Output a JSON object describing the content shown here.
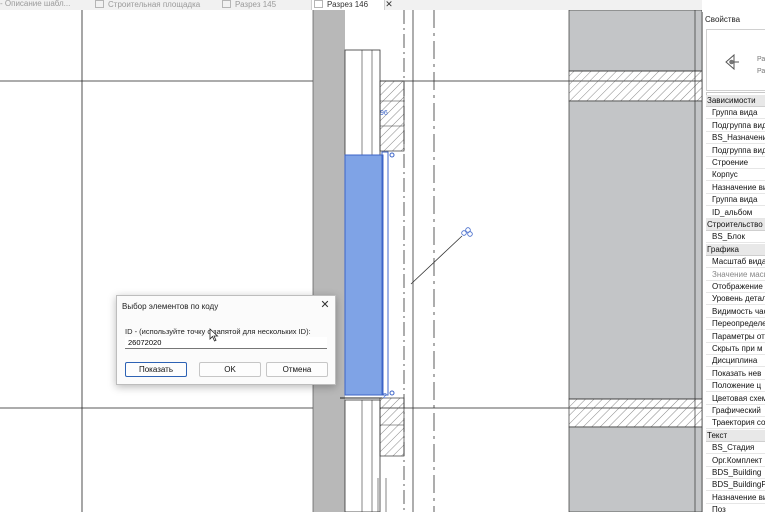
{
  "tabs": [
    {
      "label": "- Описание шабл...",
      "active": false
    },
    {
      "label": "Строительная площадка",
      "active": false
    },
    {
      "label": "Разрез 145",
      "active": false
    },
    {
      "label": "Разрез 146",
      "active": true
    }
  ],
  "tab_close": "✕",
  "canvas": {
    "tag_top": "96",
    "tag_bottom": "2"
  },
  "properties": {
    "title": "Свойства",
    "type_name_1": "Ра",
    "type_name_2": "Ра",
    "type_selector": "Разрез: Разрез",
    "groups": [
      {
        "header": "Зависимости",
        "rows": [
          "Группа вида",
          "Подгруппа вида",
          "BS_Назначение",
          "Подгруппа вида",
          "Строение",
          "Корпус",
          "Назначение вида",
          "Группа вида",
          "ID_альбом"
        ]
      },
      {
        "header": "Строительство",
        "rows": [
          "BS_Блок"
        ]
      },
      {
        "header": "Графика",
        "rows": [
          "Масштаб вида",
          "Значение масштаба",
          "Отображение",
          "Уровень детализации",
          "Видимость частей",
          "Переопределение",
          "Параметры от",
          "Скрыть при м",
          "Дисциплина",
          "Показать нев",
          "Положение ц",
          "Цветовая схема",
          "Графический",
          "Траектория со"
        ]
      },
      {
        "header": "Текст",
        "rows": [
          "BS_Стадия",
          "Орг.Комплект",
          "BDS_Building",
          "BDS_BuildingP",
          "Назначение ви",
          "Поз"
        ]
      }
    ]
  },
  "dialog": {
    "title": "Выбор элементов по коду",
    "close": "✕",
    "label": "ID - (используйте точку с запятой для нескольких ID):",
    "value": "26072020",
    "buttons": {
      "show": "Показать",
      "ok": "OK",
      "cancel": "Отмена"
    }
  },
  "colors": {
    "selection": "#7fa3e6",
    "selection_edge": "#3c64c8",
    "gray_band": "#b8b8b8",
    "panel_bg": "#c3c5c7"
  }
}
